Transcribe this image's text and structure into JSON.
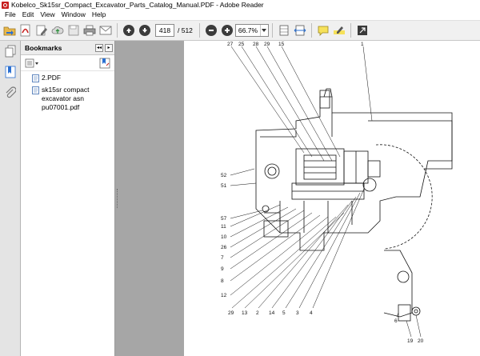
{
  "window": {
    "title": "Kobelco_Sk15sr_Compact_Excavator_Parts_Catalog_Manual.PDF - Adobe Reader"
  },
  "menu": [
    "File",
    "Edit",
    "View",
    "Window",
    "Help"
  ],
  "toolbar": {
    "page_current": "418",
    "page_total": "/ 512",
    "zoom": "66.7%",
    "icons": [
      "open-icon",
      "create-pdf-icon",
      "edit-icon",
      "cloud-icon",
      "save-icon",
      "print-icon",
      "email-icon",
      "prev-page-icon",
      "next-page-icon",
      "zoom-out-icon",
      "zoom-in-icon",
      "fit-page-icon",
      "fit-width-icon",
      "comment-icon",
      "highlight-icon",
      "expand-icon"
    ]
  },
  "bookmarks": {
    "title": "Bookmarks",
    "items": [
      {
        "label": "2.PDF"
      },
      {
        "label": "sk15sr compact excavator asn pu07001.pdf"
      }
    ]
  },
  "drawing": {
    "top_callouts": [
      "27",
      "25",
      "28",
      "29",
      "15",
      "1"
    ],
    "left_callouts": [
      "52",
      "51",
      "57",
      "11",
      "10",
      "26",
      "7",
      "9",
      "8",
      "12"
    ],
    "bottom_callouts": [
      "29",
      "13",
      "2",
      "14",
      "5",
      "3",
      "4"
    ],
    "right_callouts": [
      "6",
      "19",
      "20"
    ]
  }
}
